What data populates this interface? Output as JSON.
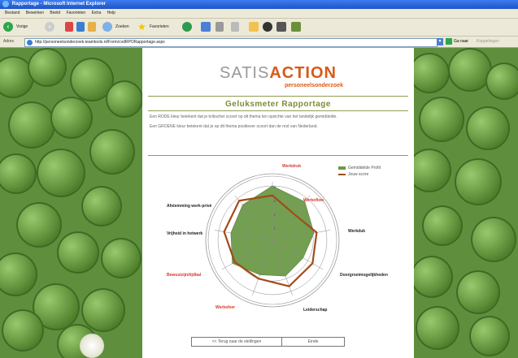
{
  "window": {
    "title": "Rapportage - Microsoft Internet Explorer",
    "menu": [
      "Bestand",
      "Bewerken",
      "Beeld",
      "Favorieten",
      "Extra",
      "Help"
    ]
  },
  "toolbar": {
    "back_label": "Vorige",
    "search_label": "Zoeken",
    "favorites_label": "Favorieten"
  },
  "address": {
    "label": "Adres",
    "url": "http://personeelsonderzoek.teamtools.nl/Form/cvdRPORapportage.aspx",
    "go_label": "Ga naar",
    "links_label": "Koppelingen"
  },
  "page": {
    "logo_satis": "SATIS",
    "logo_action": "ACTION",
    "logo_sub": "personeelsonderzoek",
    "report_title": "Geluksmeter Rapportage",
    "info_red": "Een RODE kleur betekent dat je kritischer scoort op dit thema ten opzichte van het landelijk gemiddelde.",
    "info_green": "Een GROENE kleur betekent dat je op dit thema positiever scoort dan de rest van Nederland."
  },
  "legend": {
    "series_avg": "Gemiddelde Profit",
    "series_own": "Jouw score"
  },
  "buttons": {
    "back": "<< Terug naar de stellingen",
    "end": "Einde"
  },
  "colors": {
    "accent": "#d95a18",
    "green": "#7c8d35",
    "avg_fill": "#6b9a47",
    "own_line": "#a24b1a",
    "red_label": "#d8352b"
  },
  "chart_data": {
    "type": "radar",
    "categories": [
      "Werkdruk",
      "Werkoflow",
      "Werkduk",
      "Doorgroeimogelijkheden",
      "Leiderschap",
      "Werksfeer",
      "Bewustzijn/tijdbal",
      "Vrijheid in hetwerk",
      "Afstemming werk-privé"
    ],
    "category_colors": [
      "red",
      "red",
      "green",
      "green",
      "green",
      "red",
      "red",
      "green",
      "green"
    ],
    "series": [
      {
        "name": "Gemiddelde Profit",
        "values": [
          4.0,
          3.7,
          3.1,
          2.6,
          2.8,
          2.7,
          3.4,
          3.1,
          3.4
        ]
      },
      {
        "name": "Jouw score",
        "values": [
          3.3,
          2.5,
          3.3,
          3.4,
          3.6,
          3.0,
          3.2,
          3.6,
          3.8
        ]
      }
    ],
    "ticks": [
      1,
      2,
      3,
      4
    ],
    "rmax": 4.3
  }
}
